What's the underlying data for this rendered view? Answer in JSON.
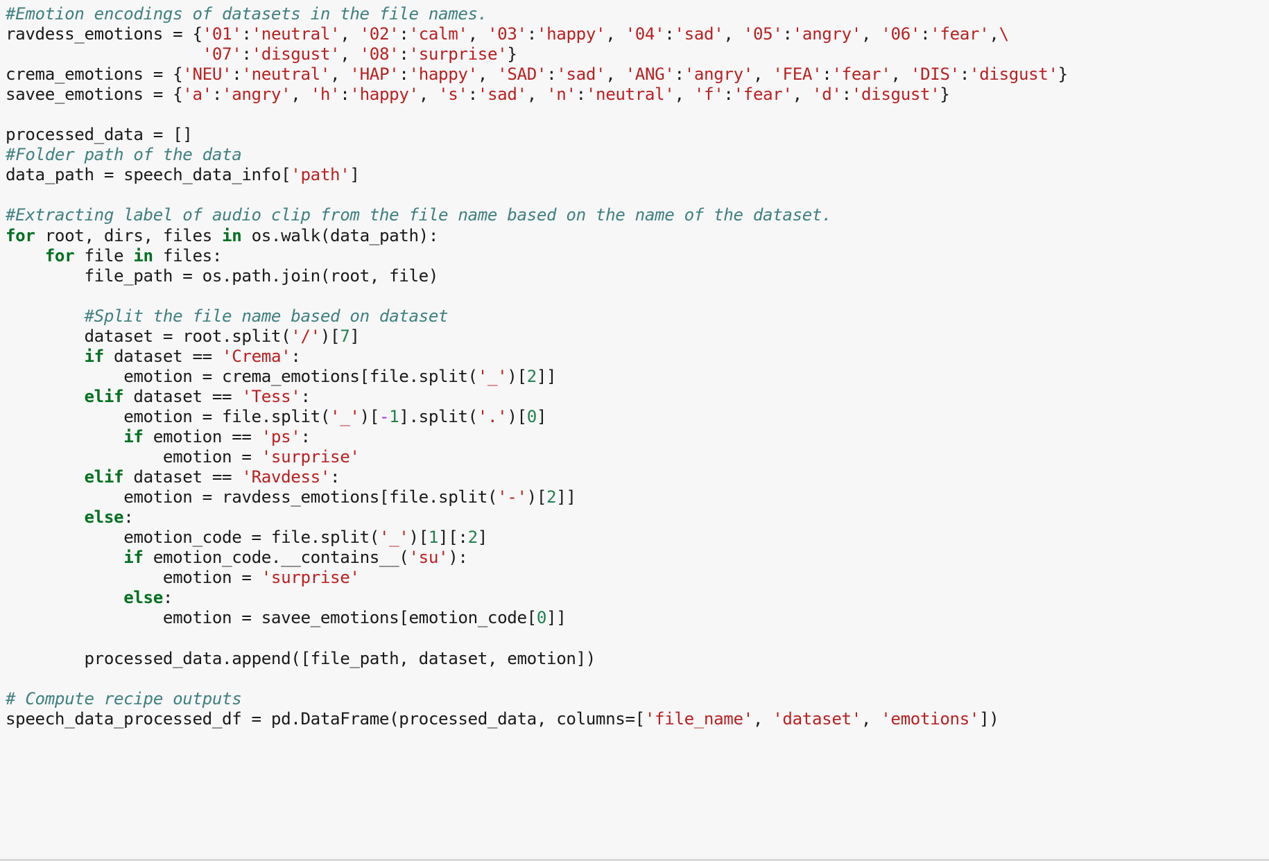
{
  "cell": {
    "kind": "code-cell",
    "language": "python",
    "background_color": "#f7f7f7",
    "colors": {
      "comment": "#408080",
      "keyword": "#007020",
      "string": "#ba2121",
      "number": "#208050",
      "operator": "#aa22ff",
      "text": "#1a1a1a"
    }
  },
  "code": {
    "lines": [
      {
        "id": 1,
        "indent": 0,
        "tokens": [
          {
            "t": "c",
            "v": "#Emotion encodings of datasets in the file names."
          }
        ]
      },
      {
        "id": 2,
        "indent": 0,
        "tokens": [
          {
            "t": "nb",
            "v": "ravdess_emotions = {"
          },
          {
            "t": "s",
            "v": "'01'"
          },
          {
            "t": "nb",
            "v": ":"
          },
          {
            "t": "s",
            "v": "'neutral'"
          },
          {
            "t": "nb",
            "v": ", "
          },
          {
            "t": "s",
            "v": "'02'"
          },
          {
            "t": "nb",
            "v": ":"
          },
          {
            "t": "s",
            "v": "'calm'"
          },
          {
            "t": "nb",
            "v": ", "
          },
          {
            "t": "s",
            "v": "'03'"
          },
          {
            "t": "nb",
            "v": ":"
          },
          {
            "t": "s",
            "v": "'happy'"
          },
          {
            "t": "nb",
            "v": ", "
          },
          {
            "t": "s",
            "v": "'04'"
          },
          {
            "t": "nb",
            "v": ":"
          },
          {
            "t": "s",
            "v": "'sad'"
          },
          {
            "t": "nb",
            "v": ", "
          },
          {
            "t": "s",
            "v": "'05'"
          },
          {
            "t": "nb",
            "v": ":"
          },
          {
            "t": "s",
            "v": "'angry'"
          },
          {
            "t": "nb",
            "v": ", "
          },
          {
            "t": "s",
            "v": "'06'"
          },
          {
            "t": "nb",
            "v": ":"
          },
          {
            "t": "s",
            "v": "'fear'"
          },
          {
            "t": "nb",
            "v": ","
          },
          {
            "t": "s",
            "v": "\\"
          }
        ]
      },
      {
        "id": 3,
        "indent": 0,
        "tokens": [
          {
            "t": "nb",
            "v": "                    "
          },
          {
            "t": "s",
            "v": "'07'"
          },
          {
            "t": "nb",
            "v": ":"
          },
          {
            "t": "s",
            "v": "'disgust'"
          },
          {
            "t": "nb",
            "v": ", "
          },
          {
            "t": "s",
            "v": "'08'"
          },
          {
            "t": "nb",
            "v": ":"
          },
          {
            "t": "s",
            "v": "'surprise'"
          },
          {
            "t": "nb",
            "v": "}"
          }
        ]
      },
      {
        "id": 4,
        "indent": 0,
        "tokens": [
          {
            "t": "nb",
            "v": "crema_emotions = {"
          },
          {
            "t": "s",
            "v": "'NEU'"
          },
          {
            "t": "nb",
            "v": ":"
          },
          {
            "t": "s",
            "v": "'neutral'"
          },
          {
            "t": "nb",
            "v": ", "
          },
          {
            "t": "s",
            "v": "'HAP'"
          },
          {
            "t": "nb",
            "v": ":"
          },
          {
            "t": "s",
            "v": "'happy'"
          },
          {
            "t": "nb",
            "v": ", "
          },
          {
            "t": "s",
            "v": "'SAD'"
          },
          {
            "t": "nb",
            "v": ":"
          },
          {
            "t": "s",
            "v": "'sad'"
          },
          {
            "t": "nb",
            "v": ", "
          },
          {
            "t": "s",
            "v": "'ANG'"
          },
          {
            "t": "nb",
            "v": ":"
          },
          {
            "t": "s",
            "v": "'angry'"
          },
          {
            "t": "nb",
            "v": ", "
          },
          {
            "t": "s",
            "v": "'FEA'"
          },
          {
            "t": "nb",
            "v": ":"
          },
          {
            "t": "s",
            "v": "'fear'"
          },
          {
            "t": "nb",
            "v": ", "
          },
          {
            "t": "s",
            "v": "'DIS'"
          },
          {
            "t": "nb",
            "v": ":"
          },
          {
            "t": "s",
            "v": "'disgust'"
          },
          {
            "t": "nb",
            "v": "}"
          }
        ]
      },
      {
        "id": 5,
        "indent": 0,
        "tokens": [
          {
            "t": "nb",
            "v": "savee_emotions = {"
          },
          {
            "t": "s",
            "v": "'a'"
          },
          {
            "t": "nb",
            "v": ":"
          },
          {
            "t": "s",
            "v": "'angry'"
          },
          {
            "t": "nb",
            "v": ", "
          },
          {
            "t": "s",
            "v": "'h'"
          },
          {
            "t": "nb",
            "v": ":"
          },
          {
            "t": "s",
            "v": "'happy'"
          },
          {
            "t": "nb",
            "v": ", "
          },
          {
            "t": "s",
            "v": "'s'"
          },
          {
            "t": "nb",
            "v": ":"
          },
          {
            "t": "s",
            "v": "'sad'"
          },
          {
            "t": "nb",
            "v": ", "
          },
          {
            "t": "s",
            "v": "'n'"
          },
          {
            "t": "nb",
            "v": ":"
          },
          {
            "t": "s",
            "v": "'neutral'"
          },
          {
            "t": "nb",
            "v": ", "
          },
          {
            "t": "s",
            "v": "'f'"
          },
          {
            "t": "nb",
            "v": ":"
          },
          {
            "t": "s",
            "v": "'fear'"
          },
          {
            "t": "nb",
            "v": ", "
          },
          {
            "t": "s",
            "v": "'d'"
          },
          {
            "t": "nb",
            "v": ":"
          },
          {
            "t": "s",
            "v": "'disgust'"
          },
          {
            "t": "nb",
            "v": "}"
          }
        ]
      },
      {
        "id": 6,
        "indent": 0,
        "tokens": []
      },
      {
        "id": 7,
        "indent": 0,
        "tokens": [
          {
            "t": "nb",
            "v": "processed_data = []"
          }
        ]
      },
      {
        "id": 8,
        "indent": 0,
        "tokens": [
          {
            "t": "c",
            "v": "#Folder path of the data"
          }
        ]
      },
      {
        "id": 9,
        "indent": 0,
        "tokens": [
          {
            "t": "nb",
            "v": "data_path = speech_data_info["
          },
          {
            "t": "s",
            "v": "'path'"
          },
          {
            "t": "nb",
            "v": "]"
          }
        ]
      },
      {
        "id": 10,
        "indent": 0,
        "tokens": []
      },
      {
        "id": 11,
        "indent": 0,
        "tokens": [
          {
            "t": "c",
            "v": "#Extracting label of audio clip from the file name based on the name of the dataset."
          }
        ]
      },
      {
        "id": 12,
        "indent": 0,
        "tokens": [
          {
            "t": "k",
            "v": "for"
          },
          {
            "t": "nb",
            "v": " root, dirs, files "
          },
          {
            "t": "k",
            "v": "in"
          },
          {
            "t": "nb",
            "v": " os.walk(data_path):"
          }
        ]
      },
      {
        "id": 13,
        "indent": 4,
        "tokens": [
          {
            "t": "k",
            "v": "for"
          },
          {
            "t": "nb",
            "v": " file "
          },
          {
            "t": "k",
            "v": "in"
          },
          {
            "t": "nb",
            "v": " files:"
          }
        ]
      },
      {
        "id": 14,
        "indent": 8,
        "tokens": [
          {
            "t": "nb",
            "v": "file_path = os.path.join(root, file)"
          }
        ]
      },
      {
        "id": 15,
        "indent": 0,
        "tokens": []
      },
      {
        "id": 16,
        "indent": 8,
        "tokens": [
          {
            "t": "c",
            "v": "#Split the file name based on dataset"
          }
        ]
      },
      {
        "id": 17,
        "indent": 8,
        "tokens": [
          {
            "t": "nb",
            "v": "dataset = root.split("
          },
          {
            "t": "s",
            "v": "'/'"
          },
          {
            "t": "nb",
            "v": ")["
          },
          {
            "t": "n",
            "v": "7"
          },
          {
            "t": "nb",
            "v": "]"
          }
        ]
      },
      {
        "id": 18,
        "indent": 8,
        "tokens": [
          {
            "t": "k",
            "v": "if"
          },
          {
            "t": "nb",
            "v": " dataset == "
          },
          {
            "t": "s",
            "v": "'Crema'"
          },
          {
            "t": "nb",
            "v": ":"
          }
        ]
      },
      {
        "id": 19,
        "indent": 12,
        "tokens": [
          {
            "t": "nb",
            "v": "emotion = crema_emotions[file.split("
          },
          {
            "t": "s",
            "v": "'_'"
          },
          {
            "t": "nb",
            "v": ")["
          },
          {
            "t": "n",
            "v": "2"
          },
          {
            "t": "nb",
            "v": "]]"
          }
        ]
      },
      {
        "id": 20,
        "indent": 8,
        "tokens": [
          {
            "t": "k",
            "v": "elif"
          },
          {
            "t": "nb",
            "v": " dataset == "
          },
          {
            "t": "s",
            "v": "'Tess'"
          },
          {
            "t": "nb",
            "v": ":"
          }
        ]
      },
      {
        "id": 21,
        "indent": 12,
        "tokens": [
          {
            "t": "nb",
            "v": "emotion = file.split("
          },
          {
            "t": "s",
            "v": "'_'"
          },
          {
            "t": "nb",
            "v": ")["
          },
          {
            "t": "op",
            "v": "-"
          },
          {
            "t": "n",
            "v": "1"
          },
          {
            "t": "nb",
            "v": "].split("
          },
          {
            "t": "s",
            "v": "'.'"
          },
          {
            "t": "nb",
            "v": ")["
          },
          {
            "t": "n",
            "v": "0"
          },
          {
            "t": "nb",
            "v": "]"
          }
        ]
      },
      {
        "id": 22,
        "indent": 12,
        "tokens": [
          {
            "t": "k",
            "v": "if"
          },
          {
            "t": "nb",
            "v": " emotion == "
          },
          {
            "t": "s",
            "v": "'ps'"
          },
          {
            "t": "nb",
            "v": ":"
          }
        ]
      },
      {
        "id": 23,
        "indent": 16,
        "tokens": [
          {
            "t": "nb",
            "v": "emotion = "
          },
          {
            "t": "s",
            "v": "'surprise'"
          }
        ]
      },
      {
        "id": 24,
        "indent": 8,
        "tokens": [
          {
            "t": "k",
            "v": "elif"
          },
          {
            "t": "nb",
            "v": " dataset == "
          },
          {
            "t": "s",
            "v": "'Ravdess'"
          },
          {
            "t": "nb",
            "v": ":"
          }
        ]
      },
      {
        "id": 25,
        "indent": 12,
        "tokens": [
          {
            "t": "nb",
            "v": "emotion = ravdess_emotions[file.split("
          },
          {
            "t": "s",
            "v": "'-'"
          },
          {
            "t": "nb",
            "v": ")["
          },
          {
            "t": "n",
            "v": "2"
          },
          {
            "t": "nb",
            "v": "]]"
          }
        ]
      },
      {
        "id": 26,
        "indent": 8,
        "tokens": [
          {
            "t": "k",
            "v": "else"
          },
          {
            "t": "nb",
            "v": ":"
          }
        ]
      },
      {
        "id": 27,
        "indent": 12,
        "tokens": [
          {
            "t": "nb",
            "v": "emotion_code = file.split("
          },
          {
            "t": "s",
            "v": "'_'"
          },
          {
            "t": "nb",
            "v": ")["
          },
          {
            "t": "n",
            "v": "1"
          },
          {
            "t": "nb",
            "v": "][:"
          },
          {
            "t": "n",
            "v": "2"
          },
          {
            "t": "nb",
            "v": "]"
          }
        ]
      },
      {
        "id": 28,
        "indent": 12,
        "tokens": [
          {
            "t": "k",
            "v": "if"
          },
          {
            "t": "nb",
            "v": " emotion_code.__contains__("
          },
          {
            "t": "s",
            "v": "'su'"
          },
          {
            "t": "nb",
            "v": "):"
          }
        ]
      },
      {
        "id": 29,
        "indent": 16,
        "tokens": [
          {
            "t": "nb",
            "v": "emotion = "
          },
          {
            "t": "s",
            "v": "'surprise'"
          }
        ]
      },
      {
        "id": 30,
        "indent": 12,
        "tokens": [
          {
            "t": "k",
            "v": "else"
          },
          {
            "t": "nb",
            "v": ":"
          }
        ]
      },
      {
        "id": 31,
        "indent": 16,
        "tokens": [
          {
            "t": "nb",
            "v": "emotion = savee_emotions[emotion_code["
          },
          {
            "t": "n",
            "v": "0"
          },
          {
            "t": "nb",
            "v": "]]"
          }
        ]
      },
      {
        "id": 32,
        "indent": 0,
        "tokens": []
      },
      {
        "id": 33,
        "indent": 8,
        "tokens": [
          {
            "t": "nb",
            "v": "processed_data.append([file_path, dataset, emotion])"
          }
        ]
      },
      {
        "id": 34,
        "indent": 0,
        "tokens": []
      },
      {
        "id": 35,
        "indent": 0,
        "tokens": [
          {
            "t": "c",
            "v": "# Compute recipe outputs"
          }
        ]
      },
      {
        "id": 36,
        "indent": 0,
        "tokens": [
          {
            "t": "nb",
            "v": "speech_data_processed_df = pd.DataFrame(processed_data, columns=["
          },
          {
            "t": "s",
            "v": "'file_name'"
          },
          {
            "t": "nb",
            "v": ", "
          },
          {
            "t": "s",
            "v": "'dataset'"
          },
          {
            "t": "nb",
            "v": ", "
          },
          {
            "t": "s",
            "v": "'emotions'"
          },
          {
            "t": "nb",
            "v": "])"
          }
        ]
      }
    ]
  }
}
